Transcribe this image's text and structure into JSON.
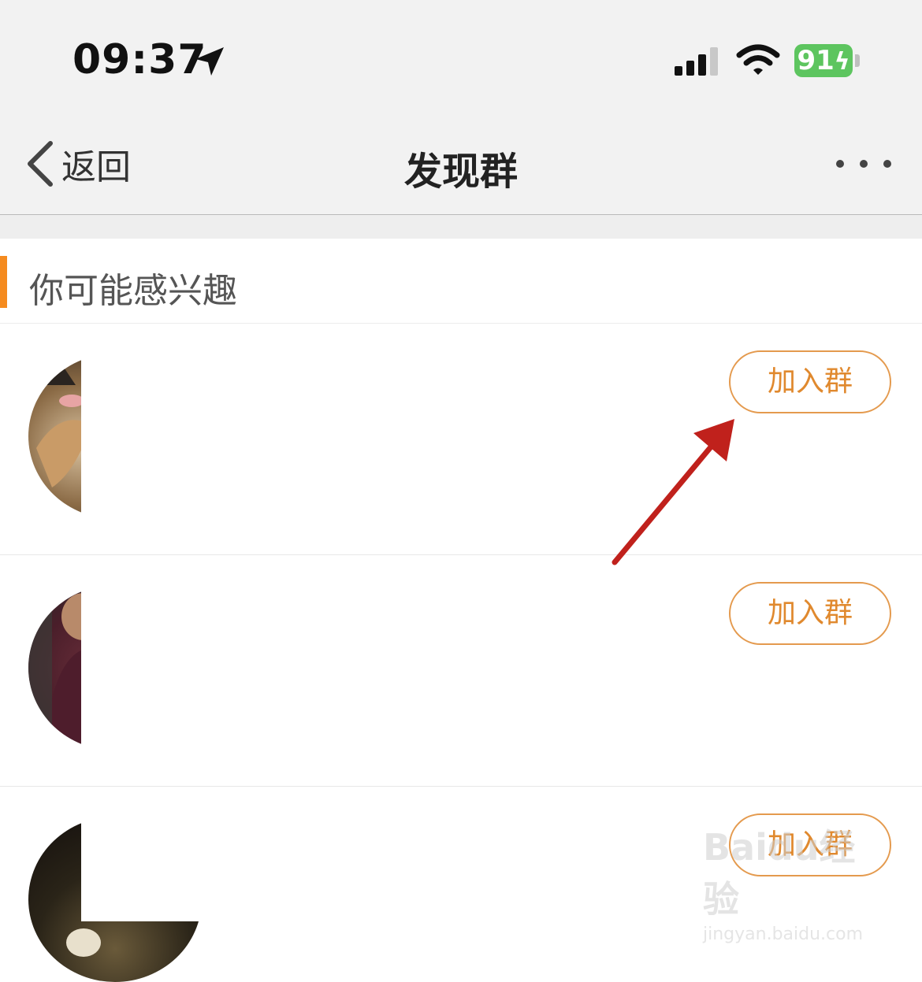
{
  "status_bar": {
    "time": "09:37",
    "battery": "91",
    "battery_color": "#5dc55f"
  },
  "nav": {
    "back_label": "返回",
    "title": "发现群"
  },
  "section": {
    "title": "你可能感兴趣",
    "accent_color": "#f58b1f"
  },
  "groups": [
    {
      "avatar": "husky-dog-photo",
      "join_label": "加入群"
    },
    {
      "avatar": "person-in-hoodie-photo",
      "join_label": "加入群"
    },
    {
      "avatar": "dark-photo",
      "join_label": "加入群"
    }
  ],
  "watermark": {
    "logo": "Baidu经验",
    "url": "jingyan.baidu.com"
  },
  "colors": {
    "join_button": "#e0892e",
    "annotation_arrow": "#c0211c"
  }
}
